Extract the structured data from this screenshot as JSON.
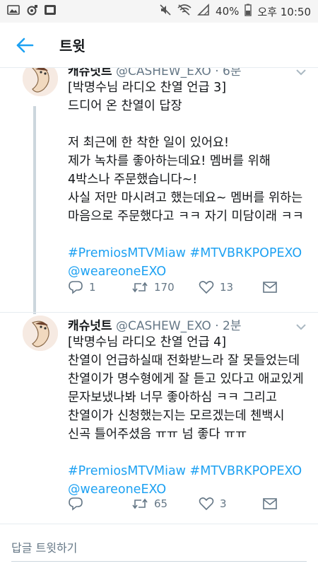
{
  "status_bar": {
    "left_icons": [
      "gallery-icon",
      "camera-icon",
      "app-icon"
    ],
    "battery": "40%",
    "time": "오후 10:50"
  },
  "app_bar": {
    "title": "트윗"
  },
  "tweets": [
    {
      "name": "캐슈넛트",
      "handle": "@CASHEW_EXO",
      "time": "6분",
      "lines": [
        "[박명수님 라디오 찬열 언급 3]",
        "드디어 온 찬열이 답장",
        "",
        "저 최근에 한 착한 일이 있어요!",
        "제가 녹차를 좋아하는데요! 멤버를 위해",
        "4박스나 주문했습니다~!",
        "사실 저만 마시려고 했는데요~ 멤버를 위하는",
        "마음으로 주문했다고 ㅋㅋ 자기 미담이래 ㅋㅋ"
      ],
      "hashtags": "#PremiosMTVMiaw #MTVBRKPOPEXO",
      "mention": "@weareoneEXO",
      "replies": "1",
      "retweets": "170",
      "likes": "13"
    },
    {
      "name": "캐슈넛트",
      "handle": "@CASHEW_EXO",
      "time": "2분",
      "lines": [
        "[박명수님 라디오 찬열 언급 4]",
        "찬열이 언급하실때 전화받느라 잘 못들었는데",
        "찬열이가 명수형에게 잘 듣고 있다고 애교있게",
        "문자보냈나봐 너무 좋아하심 ㅋㅋ 그리고",
        "찬열이가 신청했는지는 모르겠는데 첸백시",
        "신곡 틀어주셨음 ㅠㅠ 넘 좋다 ㅠㅠ"
      ],
      "hashtags": "#PremiosMTVMiaw #MTVBRKPOPEXO",
      "mention": "@weareoneEXO",
      "replies": "",
      "retweets": "65",
      "likes": "3"
    }
  ],
  "reply_bar": {
    "placeholder": "답글 트윗하기"
  },
  "colors": {
    "link": "#1da1f2",
    "muted": "#657786",
    "accent": "#1da1f2"
  }
}
